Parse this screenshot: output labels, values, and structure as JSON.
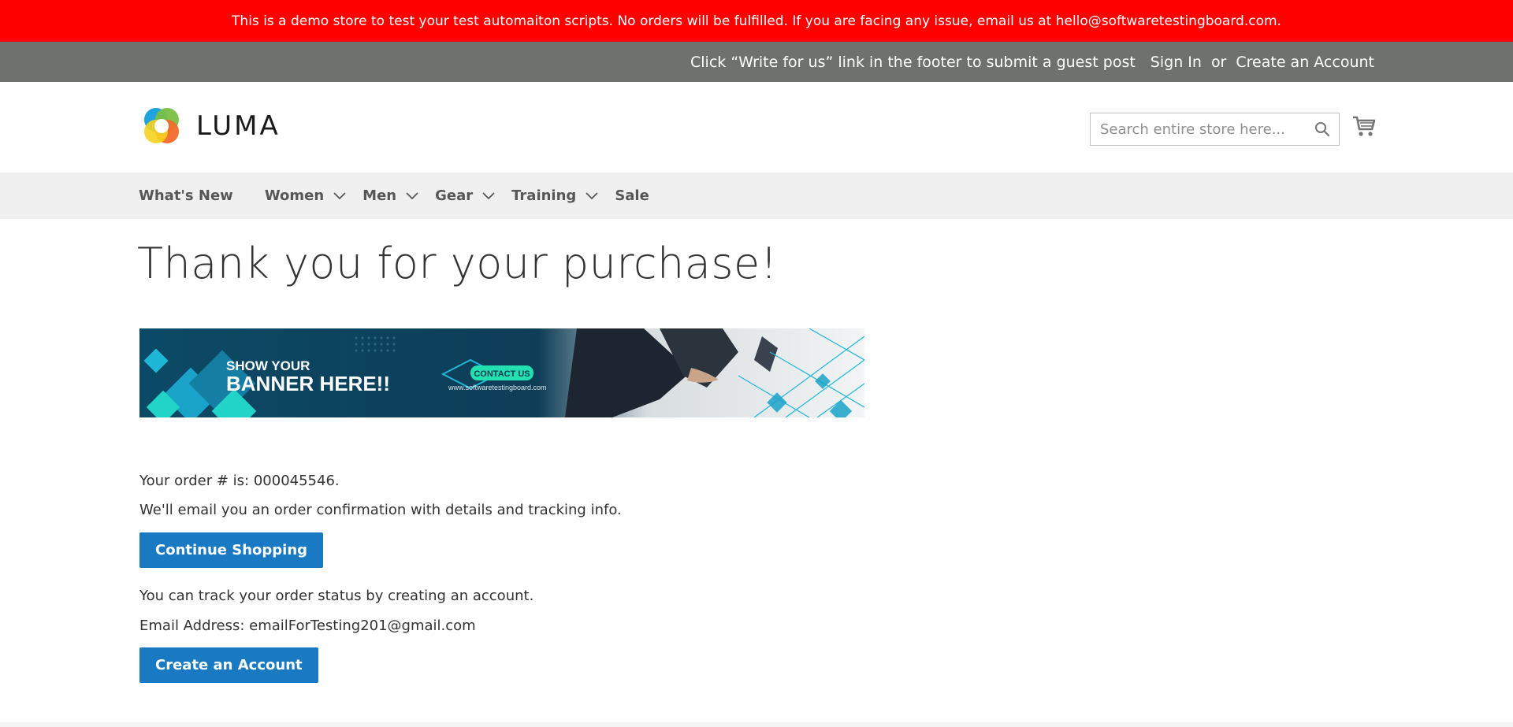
{
  "demo_notice": "This is a demo store to test your test automaiton scripts. No orders will be fulfilled. If you are facing any issue, email us at hello@softwaretestingboard.com.",
  "header_panel": {
    "promo": "Click “Write for us” link in the footer to submit a guest post",
    "sign_in": "Sign In",
    "separator": "or",
    "create_account": "Create an Account"
  },
  "logo": {
    "text": "LUMA"
  },
  "search": {
    "placeholder": "Search entire store here...",
    "value": ""
  },
  "nav": {
    "whats_new": "What's New",
    "women": "Women",
    "men": "Men",
    "gear": "Gear",
    "training": "Training",
    "sale": "Sale"
  },
  "page_title": "Thank you for your purchase!",
  "banner": {
    "line1": "SHOW YOUR",
    "line2": "BANNER HERE!!",
    "contact": "CONTACT US",
    "url": "www.softwaretestingboard.com"
  },
  "order": {
    "number_label": "Your order # is: ",
    "number": "000045546",
    "number_suffix": ".",
    "email_note": "We'll email you an order confirmation with details and tracking info.",
    "continue_button": "Continue Shopping",
    "track_note": "You can track your order status by creating an account.",
    "email_label": "Email Address: ",
    "email": "emailForTesting201@gmail.com",
    "create_account_button": "Create an Account"
  },
  "colors": {
    "demo_notice_bg": "#ff0000",
    "header_panel_bg": "#6e716e",
    "nav_bg": "#f0f0f0",
    "primary_button": "#1979c3"
  },
  "icons": {
    "search": "search-icon",
    "cart": "cart-icon",
    "chevron": "chevron-down-icon"
  }
}
